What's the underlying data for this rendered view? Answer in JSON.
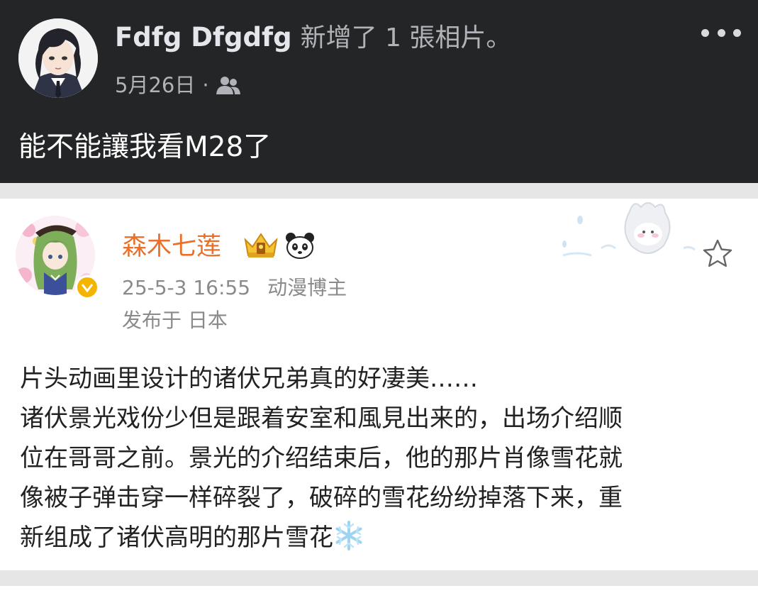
{
  "fb_post": {
    "author": "Fdfg Dfgdfg",
    "action": "新增了 1 張相片。",
    "date": "5月26日",
    "separator": "·",
    "audience_icon": "friends-icon",
    "more_icon": "more-options-icon",
    "text": "能不能讓我看M28了"
  },
  "weibo_post": {
    "user_name": "森木七莲",
    "badges": [
      "crown-badge-icon",
      "panda-badge-icon"
    ],
    "verified_icon": "verified-badge-icon",
    "timestamp": "25-5-3 16:55",
    "role": "动漫博主",
    "location": "发布于 日本",
    "favorite_icon": "star-icon",
    "body_lines": [
      "片头动画里设计的诸伏兄弟真的好凄美……",
      "诸伏景光戏份少但是跟着安室和風見出来的，出场介绍顺",
      "位在哥哥之前。景光的介绍结束后，他的那片肖像雪花就",
      "像被子弹击穿一样碎裂了，破碎的雪花纷纷掉落下来，重",
      "新组成了诸伏高明的那片雪花"
    ],
    "emoji_icon": "snowflake-emoji-icon"
  },
  "colors": {
    "fb_background": "#242526",
    "weibo_name": "#e8702a",
    "verified": "#f5b400",
    "page_gap": "#e6e6e6"
  }
}
